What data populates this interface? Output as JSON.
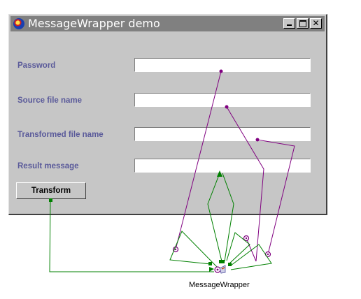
{
  "window": {
    "title": "MessageWrapper demo",
    "minimize_glyph": "",
    "maximize_glyph": "",
    "close_glyph": "✕"
  },
  "form": {
    "password_label": "Password",
    "password_value": "",
    "source_label": "Source file name",
    "source_value": "",
    "transformed_label": "Transformed file name",
    "transformed_value": "",
    "result_label": "Result message",
    "result_value": ""
  },
  "transform_button_label": "Transform",
  "bean": {
    "label": "MessageWrapper"
  },
  "colors": {
    "titlebar": "#808080",
    "window_bg": "#c6c6c6",
    "label_text": "#5a5a9a",
    "connection_purple": "#800080",
    "connection_green": "#008000"
  }
}
